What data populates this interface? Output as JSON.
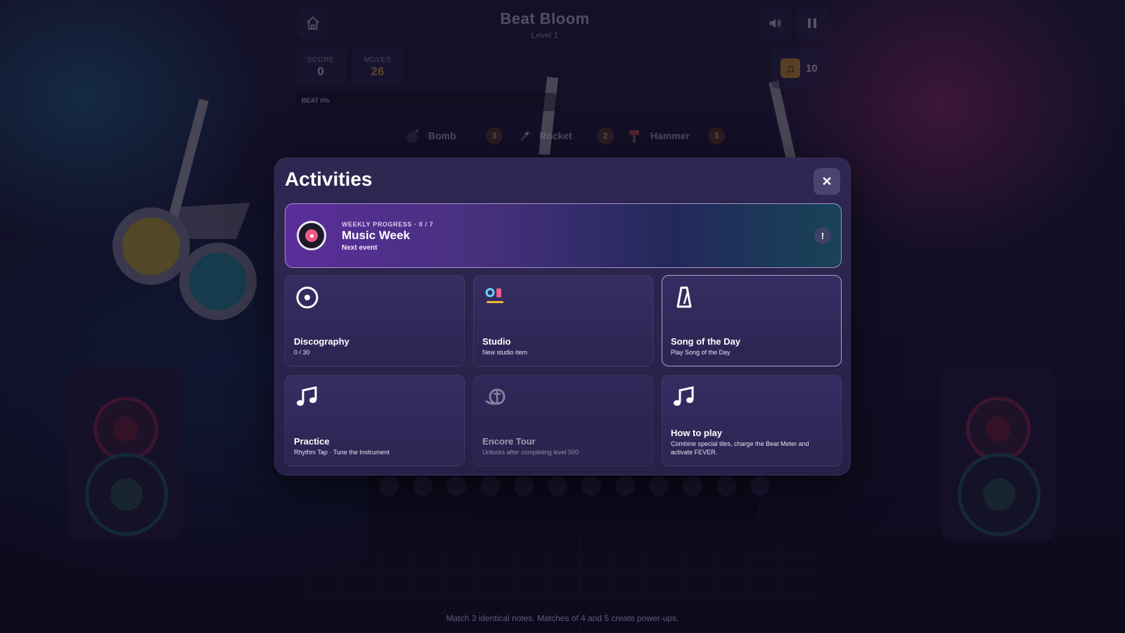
{
  "game": {
    "title": "Beat Bloom",
    "level": "Level 1",
    "score_label": "SCORE",
    "score": "0",
    "moves_label": "MOVES",
    "moves": "26",
    "coins": "10",
    "beat_label": "BEAT 0%",
    "powerups": [
      {
        "name": "Bomb",
        "count": "3"
      },
      {
        "name": "Rocket",
        "count": "2"
      },
      {
        "name": "Hammer",
        "count": "3"
      }
    ],
    "hint": "Match 3 identical notes. Matches of 4 and 5 create power-ups."
  },
  "modal": {
    "title": "Activities",
    "close_label": "✕",
    "banner": {
      "kicker": "WEEKLY PROGRESS · 0 / 7",
      "title": "Music Week",
      "subtitle": "Next event",
      "alert": "!"
    },
    "cards": [
      {
        "title": "Discography",
        "subtitle": "0 / 30",
        "icon": "disc-icon"
      },
      {
        "title": "Studio",
        "subtitle": "New studio item",
        "icon": "studio-icon"
      },
      {
        "title": "Song of the Day",
        "subtitle": "Play Song of the Day",
        "icon": "metronome-icon"
      },
      {
        "title": "Practice",
        "subtitle": "Rhythm Tap · Tune the Instrument",
        "icon": "music-note-icon"
      },
      {
        "title": "Encore Tour",
        "subtitle": "Unlocks after completing level 500",
        "icon": "tour-icon"
      },
      {
        "title": "How to play",
        "subtitle": "Combine special tiles, charge the Beat Meter and activate FEVER.",
        "icon": "music-note-icon"
      }
    ]
  },
  "colors": {
    "accent_pink": "#f05a84",
    "coin_gold": "#d39a2a",
    "modal_bg": "#2b2552"
  }
}
